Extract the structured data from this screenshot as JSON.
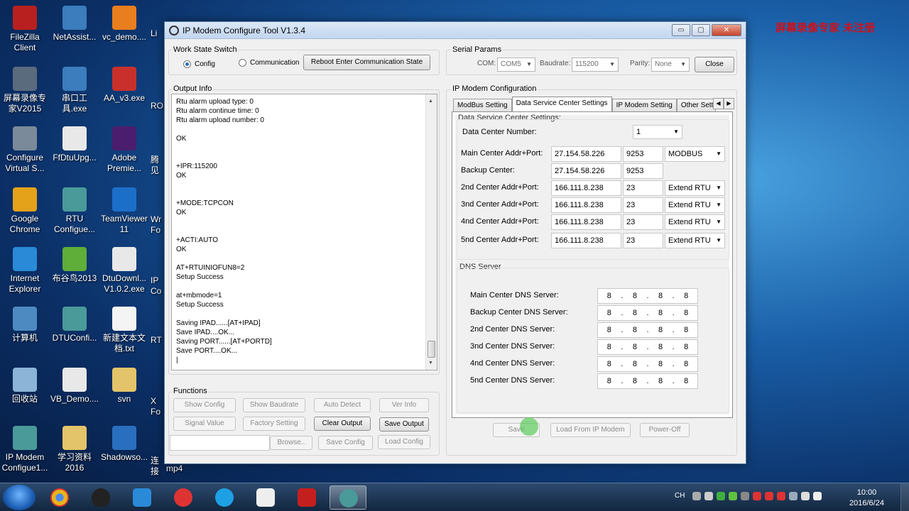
{
  "desktop": {
    "icons": [
      {
        "label": "FileZilla Client",
        "color": "#b8201f"
      },
      {
        "label": "NetAssist...",
        "color": "#3b7dbd"
      },
      {
        "label": "vc_demo....",
        "color": "#e87e1e"
      },
      {
        "label": "屏幕录像专家V2015",
        "color": "#5a6b7e"
      },
      {
        "label": "串口工具.exe",
        "color": "#3b7dbd"
      },
      {
        "label": "AA_v3.exe",
        "color": "#c9302c"
      },
      {
        "label": "Configure Virtual S...",
        "color": "#7a8a9a"
      },
      {
        "label": "FfDtuUpg...",
        "color": "#e8e8e8"
      },
      {
        "label": "Adobe Premie...",
        "color": "#4b1d6e"
      },
      {
        "label": "Google Chrome",
        "color": "#e3a21a"
      },
      {
        "label": "RTU Configue...",
        "color": "#4a9a9a"
      },
      {
        "label": "TeamViewer 11",
        "color": "#1c6fc9"
      },
      {
        "label": "Internet Explorer",
        "color": "#2a8ad8"
      },
      {
        "label": "布谷鸟2013",
        "color": "#5fae3a"
      },
      {
        "label": "DtuDownl... V1.0.2.exe",
        "color": "#e8e8e8"
      },
      {
        "label": "计算机",
        "color": "#4e8ac2"
      },
      {
        "label": "DTUConfi...",
        "color": "#4a9a9a"
      },
      {
        "label": "新建文本文档.txt",
        "color": "#f4f4f4"
      },
      {
        "label": "回收站",
        "color": "#8bb4d6"
      },
      {
        "label": "VB_Demo....",
        "color": "#e8e8e8"
      },
      {
        "label": "svn",
        "color": "#e3c46a"
      },
      {
        "label": "IP Modem Configue1...",
        "color": "#4a9a9a"
      },
      {
        "label": "学习资料2016",
        "color": "#e3c46a"
      },
      {
        "label": "Shadowso...",
        "color": "#2a6fbf"
      }
    ],
    "partial_labels": [
      "RO",
      "腾见",
      "Wr Fo",
      "IP Co",
      "RT",
      "X Fo",
      "连接",
      "Li"
    ],
    "watermark": "屏幕录像专家  未注册",
    "mp4_label": "mp4"
  },
  "window": {
    "title": "IP Modem Configure Tool V1.3.4",
    "buttons": {
      "minimize": "▭",
      "maximize": "▢",
      "close": "✕"
    }
  },
  "work_state": {
    "title": "Work State Switch",
    "config_label": "Config",
    "communication_label": "Communication",
    "selected": "Config",
    "reboot_button": "Reboot Enter Communication State"
  },
  "serial": {
    "title": "Serial Params",
    "com_label": "COM:",
    "com_value": "COM5",
    "baud_label": "Baudrate:",
    "baud_value": "115200",
    "parity_label": "Parity:",
    "parity_value": "None",
    "close_button": "Close"
  },
  "output": {
    "title": "Output Info",
    "lines": [
      "Rtu alarm upload type:     0",
      "Rtu alarm continue time:     0",
      "Rtu alarm upload number:     0",
      "",
      "OK",
      "",
      "",
      "+IPR:115200",
      "OK",
      "",
      "",
      "+MODE:TCPCON",
      "OK",
      "",
      "",
      "+ACTI:AUTO",
      "OK",
      "",
      "AT+RTUINIOFUN8=2",
      "Setup Success",
      "",
      "at+mbmode=1",
      "Setup Success",
      "",
      "Saving IPAD......[AT+IPAD]",
      "Save IPAD....OK...",
      "Saving PORT......[AT+PORTD]",
      "Save PORT....OK...",
      "|"
    ]
  },
  "functions": {
    "title": "Functions",
    "row1": [
      "Show Config",
      "Show Baudrate",
      "Auto Detect",
      "Ver Info"
    ],
    "row2": [
      "Signal Value",
      "Factory Setting",
      "Clear Output",
      "Save Output"
    ],
    "row3": [
      "Browse..",
      "Save Config",
      "Load Config"
    ]
  },
  "ipmodem": {
    "title": "IP Modem Configuration",
    "tabs": [
      "ModBus Setting",
      "Data Service Center Settings",
      "IP Modem Setting",
      "Other Sett"
    ],
    "active_tab": "Data Service Center Settings",
    "dsc_title": "Data Service Center Settings:",
    "dc_number_label": "Data Center Number:",
    "dc_number_value": "1",
    "centers": [
      {
        "label": "Main Center Addr+Port:",
        "ip": "27.154.58.226",
        "port": "9253",
        "protocol": "MODBUS"
      },
      {
        "label": "Backup Center:",
        "ip": "27.154.58.226",
        "port": "9253",
        "protocol": ""
      },
      {
        "label": "2nd Center Addr+Port:",
        "ip": "166.111.8.238",
        "port": "23",
        "protocol": "Extend RTU"
      },
      {
        "label": "3nd Center Addr+Port:",
        "ip": "166.111.8.238",
        "port": "23",
        "protocol": "Extend RTU"
      },
      {
        "label": "4nd Center Addr+Port:",
        "ip": "166.111.8.238",
        "port": "23",
        "protocol": "Extend RTU"
      },
      {
        "label": "5nd Center Addr+Port:",
        "ip": "166.111.8.238",
        "port": "23",
        "protocol": "Extend RTU"
      }
    ],
    "dns_title": "DNS Server",
    "dns": [
      {
        "label": "Main Center DNS Server:",
        "octets": [
          "8",
          "8",
          "8",
          "8"
        ]
      },
      {
        "label": "Backup Center DNS Server:",
        "octets": [
          "8",
          "8",
          "8",
          "8"
        ]
      },
      {
        "label": "2nd Center DNS Server:",
        "octets": [
          "8",
          "8",
          "8",
          "8"
        ]
      },
      {
        "label": "3nd Center DNS Server:",
        "octets": [
          "8",
          "8",
          "8",
          "8"
        ]
      },
      {
        "label": "4nd Center DNS Server:",
        "octets": [
          "8",
          "8",
          "8",
          "8"
        ]
      },
      {
        "label": "5nd Center DNS Server:",
        "octets": [
          "8",
          "8",
          "8",
          "8"
        ]
      }
    ],
    "save_button": "Save",
    "load_button": "Load From IP Modem",
    "poweroff_button": "Power-Off"
  },
  "taskbar": {
    "tray_lang": "CH",
    "time": "10:00",
    "date": "2016/6/24"
  }
}
